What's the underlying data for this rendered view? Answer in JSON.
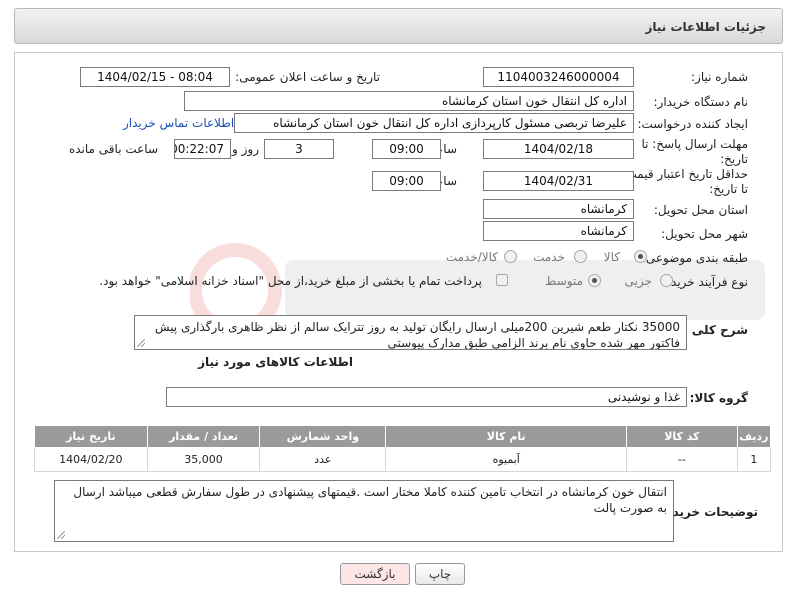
{
  "header": {
    "title": "جزئیات اطلاعات نیاز"
  },
  "form": {
    "need_number_label": "شماره نیاز:",
    "need_number_value": "1104003246000004",
    "announce_label": "تاریخ و ساعت اعلان عمومی:",
    "announce_value": "1404/02/15 - 08:04",
    "buyer_org_label": "نام دستگاه خریدار:",
    "buyer_org_value": "اداره کل انتقال خون استان کرمانشاه",
    "requester_label": "ایجاد کننده درخواست:",
    "requester_value": "علیرضا تربصی مسئول کارپردازی اداره کل انتقال خون استان کرمانشاه",
    "contact_link": "اطلاعات تماس خریدار",
    "deadline_label_1": "مهلت ارسال پاسخ: تا",
    "deadline_label_2": "تاریخ:",
    "deadline_date": "1404/02/18",
    "time_label": "ساعت",
    "deadline_time": "09:00",
    "days_value": "3",
    "days_label": "روز و",
    "remaining_value": "00:22:07",
    "remaining_label": "ساعت باقی مانده",
    "validity_label_1": "حداقل تاریخ اعتبار قیمت:",
    "validity_label_2": "تا تاریخ:",
    "validity_date": "1404/02/31",
    "validity_time_label": "ساعت",
    "validity_time": "09:00",
    "province_label": "استان محل تحویل:",
    "province_value": "کرمانشاه",
    "city_label": "شهر محل تحویل:",
    "city_value": "کرمانشاه",
    "category_label": "طبقه بندی موضوعی:",
    "category_options": [
      "کالا",
      "خدمت",
      "کالا/خدمت"
    ],
    "process_label": "نوع فرآیند خرید :",
    "process_options": [
      "جزیی",
      "متوسط"
    ],
    "payment_text": "پرداخت تمام یا بخشی از مبلغ خرید،از محل \"اسناد خزانه اسلامی\" خواهد بود.",
    "description_label": "شرح کلی نیاز:",
    "description_value": "35000 نکتار طعم شیرین 200میلی ارسال رایگان تولید به روز تترایک سالم از نظر ظاهری بارگذاری پیش فاکتور مهر شده حاوی  نام برند الزامی طبق مدارک پیوستی"
  },
  "goods": {
    "section_title": "اطلاعات کالاهای مورد نیاز",
    "group_label": "گروه کالا:",
    "group_value": "غذا و نوشیدنی",
    "columns": [
      "ردیف",
      "کد کالا",
      "نام کالا",
      "واحد شمارش",
      "تعداد / مقدار",
      "تاریخ نیاز"
    ],
    "rows": [
      [
        "1",
        "--",
        "آبمیوه",
        "عدد",
        "35,000",
        "1404/02/20"
      ]
    ]
  },
  "buyer_notes": {
    "label": "توضیحات خریدار:",
    "value": "انتقال خون کرمانشاه در انتخاب تامین کننده کاملا مختار است .قیمتهای پیشنهادی در طول سفارش قطعی میباشد ارسال به صورت پالت"
  },
  "buttons": {
    "print": "چاپ",
    "back": "بازگشت"
  },
  "colors": {
    "link": "#1a4fb4",
    "table_header": "#9a9a9a",
    "back_button": "#fde6e6"
  }
}
